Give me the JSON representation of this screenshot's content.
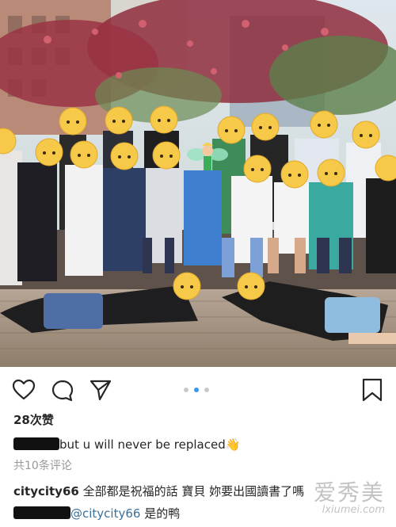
{
  "post": {
    "likes": "28次赞",
    "view_all_comments": "共10条评论",
    "carousel": {
      "count": 3,
      "active_index": 1
    }
  },
  "comments": [
    {
      "username_redacted": true,
      "text": "but u will never be replaced",
      "emoji": "👋"
    },
    {
      "username": "citycity66",
      "text": "全部都是祝福的話 寶貝 妳要出國讀書了嗎"
    },
    {
      "username_redacted": true,
      "mention": "@citycity66",
      "text": "是的鸭"
    }
  ],
  "icons": {
    "like": "heart-icon",
    "comment": "comment-bubble-icon",
    "share": "paper-plane-icon",
    "save": "bookmark-icon"
  },
  "watermark": {
    "text": "爱秀美",
    "url": "lxiumei.com"
  },
  "colors": {
    "text": "#262626",
    "muted": "#999999",
    "mention": "#3a6f9a",
    "dot_active": "#3897f0"
  }
}
